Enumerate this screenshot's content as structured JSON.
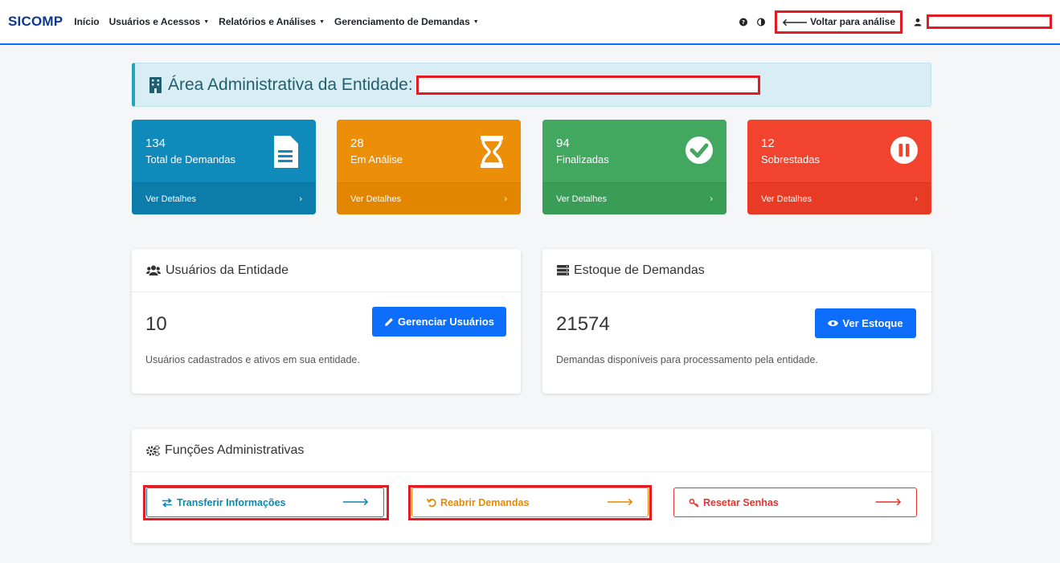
{
  "nav": {
    "brand": "SICOMP",
    "items": [
      {
        "label": "Início",
        "dropdown": false
      },
      {
        "label": "Usuários e Acessos",
        "dropdown": true
      },
      {
        "label": "Relatórios e Análises",
        "dropdown": true
      },
      {
        "label": "Gerenciamento de Demandas",
        "dropdown": true
      }
    ],
    "voltar_label": "Voltar para análise",
    "accent": "#0d6efd"
  },
  "header": {
    "title": "Área Administrativa da Entidade:"
  },
  "stats": [
    {
      "value": "134",
      "label": "Total de Demandas",
      "link": "Ver Detalhes",
      "color": "#1089bb",
      "icon": "document-icon"
    },
    {
      "value": "28",
      "label": "Em Análise",
      "link": "Ver Detalhes",
      "color": "#ec8e07",
      "icon": "hourglass-icon"
    },
    {
      "value": "94",
      "label": "Finalizadas",
      "link": "Ver Detalhes",
      "color": "#42a860",
      "icon": "check-circle-icon"
    },
    {
      "value": "12",
      "label": "Sobrestadas",
      "link": "Ver Detalhes",
      "color": "#f1432d",
      "icon": "pause-circle-icon"
    }
  ],
  "users_panel": {
    "title": "Usuários da Entidade",
    "count": "10",
    "button": "Gerenciar Usuários",
    "description": "Usuários cadastrados e ativos em sua entidade."
  },
  "stock_panel": {
    "title": "Estoque de Demandas",
    "count": "21574",
    "button": "Ver Estoque",
    "description": "Demandas disponíveis para processamento pela entidade."
  },
  "functions_panel": {
    "title": "Funções Administrativas",
    "buttons": [
      {
        "label": "Transferir Informações",
        "color": "#0b87b0"
      },
      {
        "label": "Reabrir Demandas",
        "color": "#e58a00"
      },
      {
        "label": "Resetar Senhas",
        "color": "#e3342f"
      }
    ]
  }
}
